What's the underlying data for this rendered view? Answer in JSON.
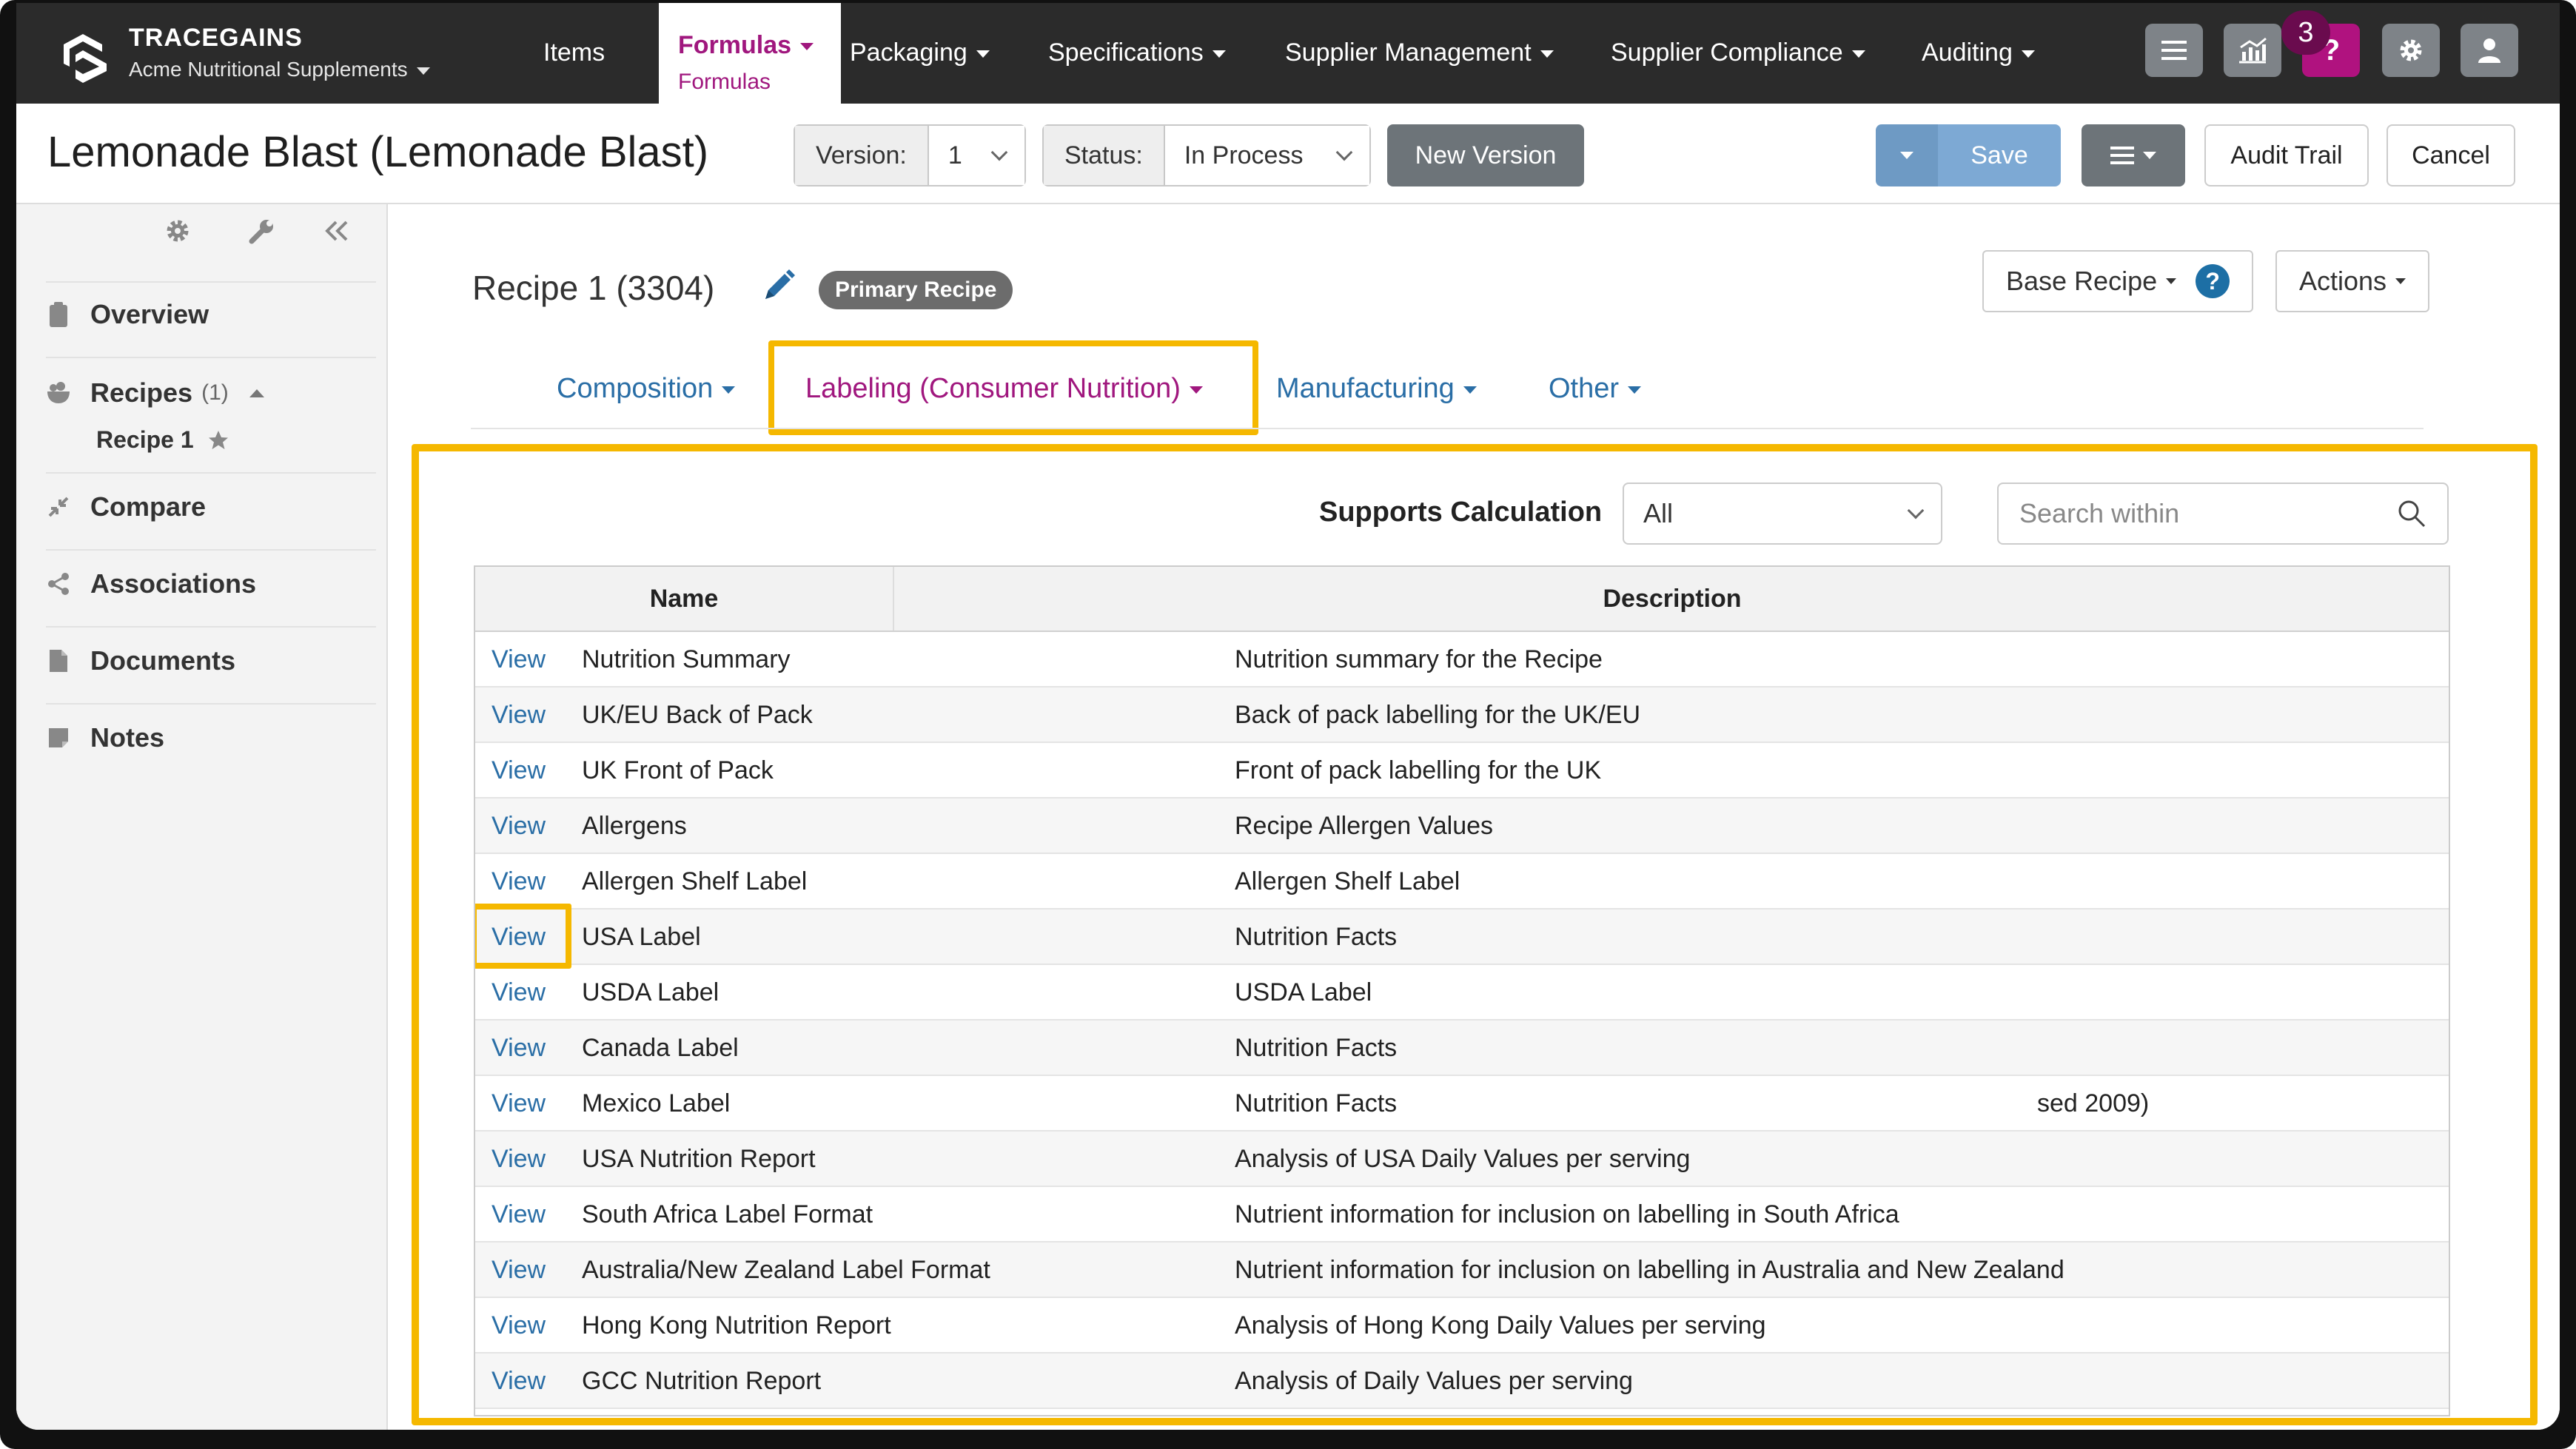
{
  "app": {
    "brand": "TRACEGAINS",
    "org": "Acme Nutritional Supplements",
    "notification_count": "3"
  },
  "nav": {
    "items": "Items",
    "formulas": "Formulas",
    "formulas_sub": "Formulas",
    "packaging": "Packaging",
    "specifications": "Specifications",
    "supplier_management": "Supplier Management",
    "supplier_compliance": "Supplier Compliance",
    "auditing": "Auditing"
  },
  "header": {
    "title": "Lemonade Blast (Lemonade Blast)",
    "version_label": "Version:",
    "version_value": "1",
    "status_label": "Status:",
    "status_value": "In Process",
    "new_version": "New Version",
    "save": "Save",
    "audit_trail": "Audit Trail",
    "cancel": "Cancel"
  },
  "sidebar": {
    "overview": "Overview",
    "recipes": "Recipes",
    "recipes_count": "(1)",
    "recipe_1": "Recipe 1",
    "compare": "Compare",
    "associations": "Associations",
    "documents": "Documents",
    "notes": "Notes"
  },
  "recipe": {
    "title": "Recipe 1 (3304)",
    "badge": "Primary Recipe",
    "base_recipe": "Base Recipe",
    "actions": "Actions"
  },
  "tabs": {
    "composition": "Composition",
    "labeling": "Labeling (Consumer Nutrition)",
    "manufacturing": "Manufacturing",
    "other": "Other"
  },
  "filters": {
    "supports_calculation": "Supports Calculation",
    "select_value": "All",
    "search_placeholder": "Search within"
  },
  "table": {
    "col_name": "Name",
    "col_description": "Description",
    "view_label": "View",
    "rows": [
      {
        "name": "Nutrition Summary",
        "desc": "Nutrition summary for the Recipe"
      },
      {
        "name": "UK/EU Back of Pack",
        "desc": "Back of pack labelling for the UK/EU"
      },
      {
        "name": "UK Front of Pack",
        "desc": "Front of pack labelling for the UK"
      },
      {
        "name": "Allergens",
        "desc": "Recipe Allergen Values"
      },
      {
        "name": "Allergen Shelf Label",
        "desc": "Allergen Shelf Label"
      },
      {
        "name": "USA Label",
        "desc": "Nutrition Facts"
      },
      {
        "name": "USDA Label",
        "desc": "USDA Label"
      },
      {
        "name": "Canada Label",
        "desc": "Nutrition Facts"
      },
      {
        "name": "Mexico Label",
        "desc": "Nutrition Facts",
        "extra": "sed 2009)"
      },
      {
        "name": "USA Nutrition Report",
        "desc": "Analysis of USA Daily Values per serving"
      },
      {
        "name": "South Africa Label Format",
        "desc": "Nutrient information for inclusion on labelling in South Africa"
      },
      {
        "name": "Australia/New Zealand Label Format",
        "desc": "Nutrient information for inclusion on labelling in Australia and New Zealand"
      },
      {
        "name": "Hong Kong Nutrition Report",
        "desc": "Analysis of Hong Kong Daily Values per serving"
      },
      {
        "name": "GCC Nutrition Report",
        "desc": "Analysis of Daily Values per serving"
      }
    ]
  },
  "colors": {
    "nav_bg": "#2b2b2b",
    "accent_magenta": "#a0177e",
    "highlight": "#f5b800",
    "link_blue": "#2a6ea6",
    "save_blue": "#7da9d4"
  }
}
